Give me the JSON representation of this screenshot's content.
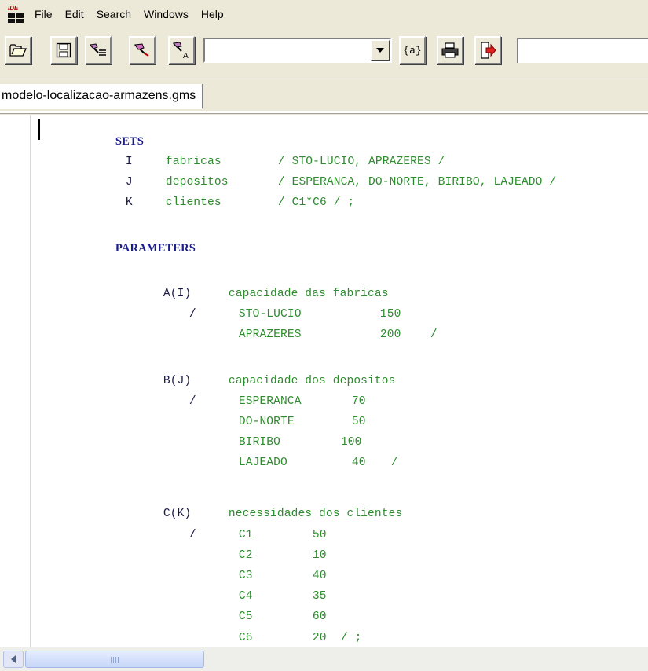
{
  "menu": {
    "items": [
      "File",
      "Edit",
      "Search",
      "Windows",
      "Help"
    ],
    "icon_text": "IDE"
  },
  "toolbar": {
    "buttons": [
      {
        "name": "open-folder-icon"
      },
      {
        "name": "save-icon"
      },
      {
        "name": "compile-icon"
      },
      {
        "name": "run-icon"
      },
      {
        "name": "run-options-icon"
      }
    ],
    "combo_value": "",
    "text_value": "",
    "tag_button_label": "{a}",
    "print_icon": "printer-icon",
    "export_icon": "export-icon"
  },
  "tabs": [
    {
      "label": "modelo-localizacao-armazens.gms"
    }
  ],
  "code": {
    "lines": [
      {
        "keyword": "SETS"
      },
      {
        "id": "I",
        "name": "fabricas",
        "value": "/ STO-LUCIO, APRAZERES /"
      },
      {
        "id": "J",
        "name": "depositos",
        "value": "/ ESPERANCA, DO-NORTE, BIRIBO, LAJEADO /"
      },
      {
        "id": "K",
        "name": "clientes",
        "value": "/ C1*C6 / ;"
      },
      {
        "keyword": "PARAMETERS"
      },
      {
        "param": "A(I)",
        "desc": "capacidade das fabricas"
      },
      {
        "slash": "/",
        "key": "STO-LUCIO",
        "num": "150"
      },
      {
        "key": "APRAZERES",
        "num": "200",
        "end": "/"
      },
      {
        "param": "B(J)",
        "desc": "capacidade dos depositos"
      },
      {
        "slash": "/",
        "key": "ESPERANCA",
        "num": "70"
      },
      {
        "key": "DO-NORTE",
        "num": "50"
      },
      {
        "key": "BIRIBO",
        "num": "100"
      },
      {
        "key": "LAJEADO",
        "num": "40",
        "end": "/"
      },
      {
        "param": "C(K)",
        "desc": "necessidades dos clientes"
      },
      {
        "slash": "/",
        "key": "C1",
        "num": "50"
      },
      {
        "key": "C2",
        "num": "10"
      },
      {
        "key": "C3",
        "num": "40"
      },
      {
        "key": "C4",
        "num": "35"
      },
      {
        "key": "C5",
        "num": "60"
      },
      {
        "key": "C6",
        "num": "20",
        "end": "/ ;"
      }
    ]
  },
  "scrollbar": {
    "left_arrow_icon": "arrow-left-icon"
  }
}
